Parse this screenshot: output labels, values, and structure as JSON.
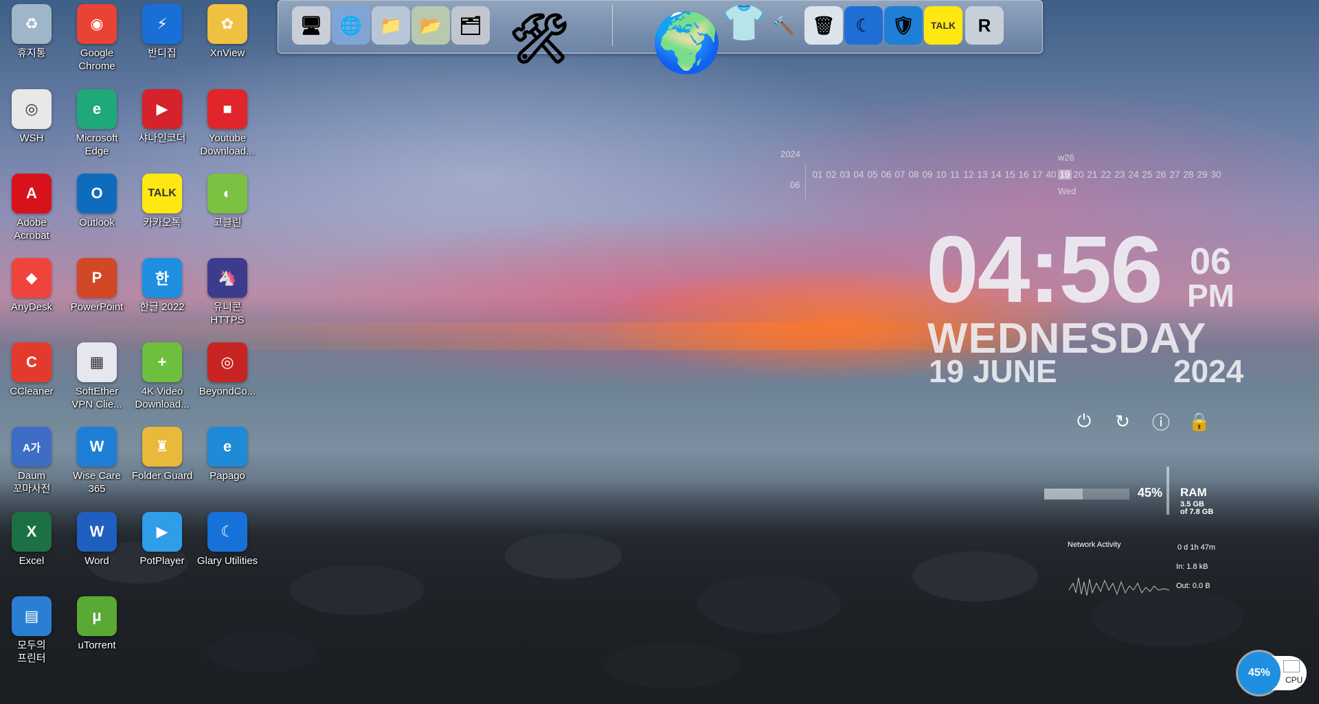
{
  "desktop": {
    "icons": [
      {
        "label": "휴지통",
        "icon": "recycle-bin-icon",
        "color": "#9fb6c9",
        "glyph": "♻"
      },
      {
        "label": "Google\nChrome",
        "icon": "chrome-icon",
        "color": "#e94335",
        "glyph": "◉"
      },
      {
        "label": "반디집",
        "icon": "bandizip-icon",
        "color": "#1a6fd6",
        "glyph": "⚡"
      },
      {
        "label": "XnView",
        "icon": "xnview-icon",
        "color": "#f0c040",
        "glyph": "✿"
      },
      {
        "label": "WSH",
        "icon": "wsh-file-icon",
        "color": "#e8e8e8",
        "glyph": "◎"
      },
      {
        "label": "Microsoft\nEdge",
        "icon": "edge-icon",
        "color": "#1fa87a",
        "glyph": "e"
      },
      {
        "label": "샤나인코더",
        "icon": "shana-encoder-icon",
        "color": "#d6222b",
        "glyph": "▶"
      },
      {
        "label": "Youtube\nDownload...",
        "icon": "youtube-downloader-icon",
        "color": "#e0262b",
        "glyph": "■"
      },
      {
        "label": "Adobe\nAcrobat",
        "icon": "acrobat-icon",
        "color": "#d8121b",
        "glyph": "A"
      },
      {
        "label": "Outlook",
        "icon": "outlook-icon",
        "color": "#0f6cbd",
        "glyph": "O"
      },
      {
        "label": "카카오톡",
        "icon": "kakaotalk-icon",
        "color": "#ffe812",
        "glyph": "TALK"
      },
      {
        "label": "고클린",
        "icon": "goclean-icon",
        "color": "#7cc242",
        "glyph": "◐"
      },
      {
        "label": "AnyDesk",
        "icon": "anydesk-icon",
        "color": "#ef443b",
        "glyph": "◆"
      },
      {
        "label": "PowerPoint",
        "icon": "powerpoint-icon",
        "color": "#d24726",
        "glyph": "P"
      },
      {
        "label": "한글 2022",
        "icon": "hangul-icon",
        "color": "#1f8fe0",
        "glyph": "한"
      },
      {
        "label": "유니콘\nHTTPS",
        "icon": "unicorn-https-icon",
        "color": "#3d3c8c",
        "glyph": "🦄"
      },
      {
        "label": "CCleaner",
        "icon": "ccleaner-icon",
        "color": "#e23b2e",
        "glyph": "C"
      },
      {
        "label": "SoftEther\nVPN Clie...",
        "icon": "softether-icon",
        "color": "#e6e6ef",
        "glyph": "▦"
      },
      {
        "label": "4K Video\nDownload...",
        "icon": "4k-video-downloader-icon",
        "color": "#6fbf3f",
        "glyph": "+"
      },
      {
        "label": "BeyondCo...",
        "icon": "beyond-compare-icon",
        "color": "#c82323",
        "glyph": "◎"
      },
      {
        "label": "Daum\n꼬마사전",
        "icon": "daum-dictionary-icon",
        "color": "#3d6dc4",
        "glyph": "A가"
      },
      {
        "label": "Wise Care\n365",
        "icon": "wise-care-icon",
        "color": "#1f7fd6",
        "glyph": "W"
      },
      {
        "label": "Folder Guard",
        "icon": "folder-guard-icon",
        "color": "#e8b93a",
        "glyph": "♜"
      },
      {
        "label": "Papago",
        "icon": "papago-icon",
        "color": "#1e8ad8",
        "glyph": "e"
      },
      {
        "label": "Excel",
        "icon": "excel-icon",
        "color": "#1d7044",
        "glyph": "X"
      },
      {
        "label": "Word",
        "icon": "word-icon",
        "color": "#1f5fbf",
        "glyph": "W"
      },
      {
        "label": "PotPlayer",
        "icon": "potplayer-icon",
        "color": "#2f9de8",
        "glyph": "▶"
      },
      {
        "label": "Glary Utilities",
        "icon": "glary-utilities-icon",
        "color": "#1672d8",
        "glyph": "☾"
      },
      {
        "label": "모두의\n프린터",
        "icon": "modu-printer-icon",
        "color": "#2b7fd3",
        "glyph": "▤"
      },
      {
        "label": "uTorrent",
        "icon": "utorrent-icon",
        "color": "#5aa935",
        "glyph": "μ"
      }
    ]
  },
  "dock": {
    "items": [
      {
        "icon": "computer-icon",
        "glyph": "🖥"
      },
      {
        "icon": "network-globe-icon",
        "glyph": "🌐"
      },
      {
        "icon": "folder-icon",
        "glyph": "📁"
      },
      {
        "icon": "documents-folder-icon",
        "glyph": "📂"
      },
      {
        "icon": "pictures-folder-icon",
        "glyph": "🗂"
      },
      {
        "icon": "tools-icon",
        "glyph": "🛠"
      },
      {
        "icon": "globe-icon",
        "glyph": "🌍"
      },
      {
        "icon": "tshirt-icon",
        "glyph": "👕"
      },
      {
        "icon": "hammer-icon",
        "glyph": "🔨"
      },
      {
        "icon": "trash-bin-icon",
        "glyph": "🗑"
      },
      {
        "icon": "moon-icon",
        "glyph": "☾"
      },
      {
        "icon": "wise-shield-icon",
        "glyph": "🛡"
      },
      {
        "icon": "kakaotalk-dock-icon",
        "glyph": "TALK"
      },
      {
        "icon": "restore-icon",
        "glyph": "R"
      }
    ]
  },
  "calendar": {
    "year": "2024",
    "month": "06",
    "week": "w26",
    "days": [
      "01",
      "02",
      "03",
      "04",
      "05",
      "06",
      "07",
      "08",
      "09",
      "10",
      "11",
      "12",
      "13",
      "14",
      "15",
      "16",
      "17",
      "40",
      "19",
      "20",
      "21",
      "22",
      "23",
      "24",
      "25",
      "26",
      "27",
      "28",
      "29",
      "30"
    ],
    "today": "19",
    "dayname": "Wed"
  },
  "clock": {
    "time": "04:56",
    "seconds": "06",
    "ampm": "PM",
    "weekday": "WEDNESDAY",
    "date": "19 JUNE",
    "year": "2024"
  },
  "power_buttons": [
    "power-icon",
    "restart-icon",
    "shutdown-info-icon",
    "lock-icon"
  ],
  "ram": {
    "percent": "45%",
    "percent_value": 0.45,
    "label": "RAM",
    "used": "3.5 GB",
    "total": "of 7.8 GB"
  },
  "network": {
    "title": "Network Activity",
    "uptime": "0 d 1h 47m",
    "in": "In: 1.8 kB",
    "out": "Out: 0.0 B"
  },
  "cpu": {
    "percent": "45%",
    "label": "CPU",
    "color": "#1f8fe0"
  }
}
